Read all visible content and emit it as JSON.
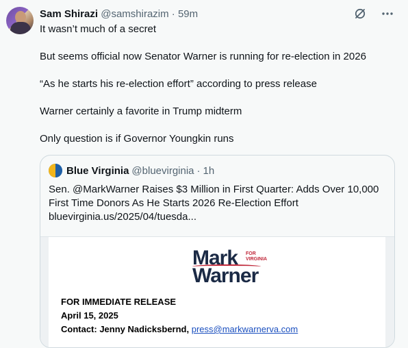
{
  "tweet": {
    "author_name": "Sam Shirazi",
    "author_handle": "@samshirazim",
    "separator": "·",
    "time": "59m",
    "paragraphs": [
      "It wasn’t much of a secret",
      "But seems official now Senator Warner is running for re-election in 2026",
      "“As he starts his re-election effort” according to press release",
      "Warner certainly a favorite in Trump midterm",
      "Only question is if Governor Youngkin runs"
    ],
    "icons": [
      "grok-icon",
      "more-icon"
    ]
  },
  "quote": {
    "author_name": "Blue Virginia",
    "author_handle": "@bluevirginia",
    "separator": "·",
    "time": "1h",
    "lines": [
      "Sen. @MarkWarner Raises $3 Million in First Quarter: Adds Over 10,000",
      "First Time Donors As He Starts 2026 Re-Election Effort",
      "bluevirginia.us/2025/04/tuesda..."
    ],
    "image": {
      "logo_top": "Mark",
      "logo_bottom": "Warner",
      "logo_for_1": "FOR",
      "logo_for_2": "VIRGINIA",
      "release_label": "FOR IMMEDIATE RELEASE",
      "date": "April 15, 2025",
      "contact_label": "Contact: Jenny Nadicksbernd,",
      "contact_email": "press@markwarnerva.com"
    }
  }
}
